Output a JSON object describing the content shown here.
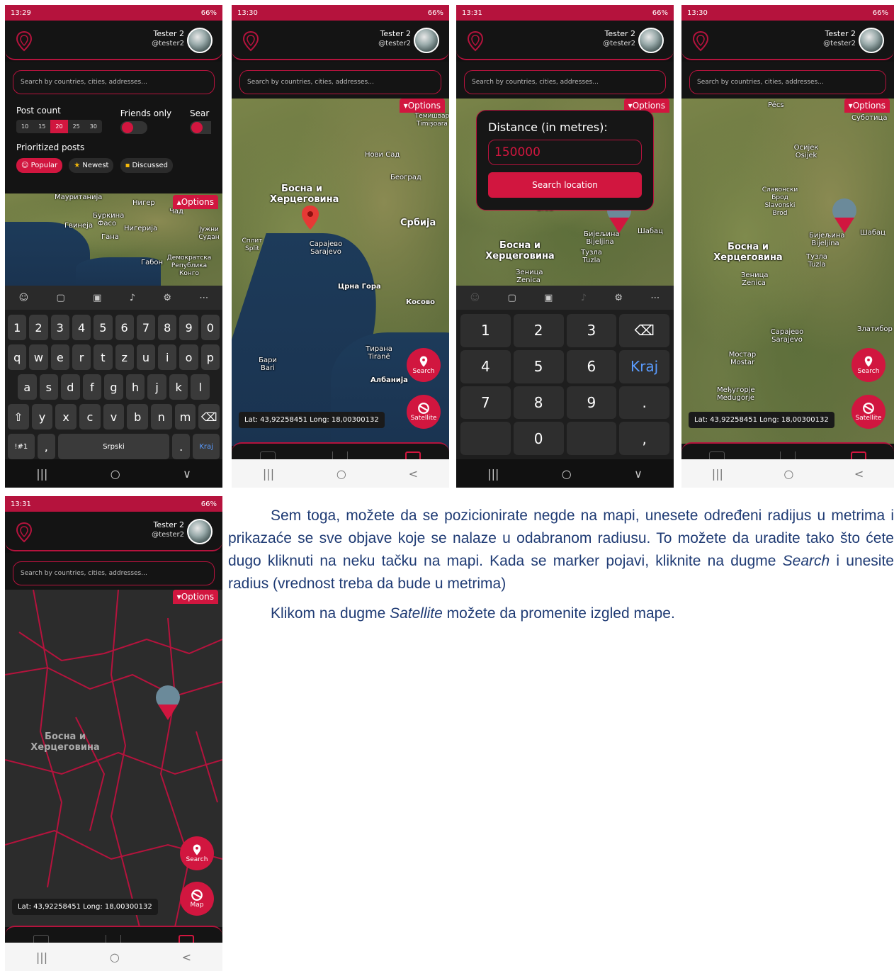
{
  "colors": {
    "accent": "#d1163f",
    "dark": "#141414"
  },
  "common": {
    "user_name": "Tester 2",
    "user_handle": "@tester2",
    "search_placeholder": "Search by countries, cities, addresses...",
    "options_label": "Options",
    "coords": "Lat: 43,92258451   Long: 18,00300132",
    "fab_search": "Search",
    "fab_satellite": "Satellite",
    "fab_map": "Map"
  },
  "phones": [
    {
      "time": "13:29",
      "status_right": "66%"
    },
    {
      "time": "13:30",
      "status_right": "66%"
    },
    {
      "time": "13:31",
      "status_right": "66%"
    },
    {
      "time": "13:30",
      "status_right": "66%"
    },
    {
      "time": "13:31",
      "status_right": "66%"
    }
  ],
  "filter_panel": {
    "post_count_label": "Post count",
    "post_counts": [
      "10",
      "15",
      "20",
      "25",
      "30"
    ],
    "post_count_selected": "20",
    "friends_only_label": "Friends only",
    "search_label": "Sear",
    "prioritized_label": "Prioritized posts",
    "chips": [
      "Popular",
      "Newest",
      "Discussed"
    ],
    "chip_selected": "Popular"
  },
  "keyboard": {
    "row_numbers": [
      "1",
      "2",
      "3",
      "4",
      "5",
      "6",
      "7",
      "8",
      "9",
      "0"
    ],
    "row_q": [
      "q",
      "w",
      "e",
      "r",
      "t",
      "z",
      "u",
      "i",
      "o",
      "p"
    ],
    "row_a": [
      "a",
      "s",
      "d",
      "f",
      "g",
      "h",
      "j",
      "k",
      "l"
    ],
    "row_y": [
      "⇧",
      "y",
      "x",
      "c",
      "v",
      "b",
      "n",
      "m",
      "⌫"
    ],
    "sym_key": "!#1",
    "comma": ",",
    "space_label": "Srpski",
    "period": ".",
    "enter_label": "Kraj"
  },
  "numpad": {
    "keys": [
      "1",
      "2",
      "3",
      "⌫",
      "4",
      "5",
      "6",
      "Kraj",
      "7",
      "8",
      "9",
      ".",
      "",
      "0",
      "",
      ","
    ]
  },
  "distance_dialog": {
    "title": "Distance (in metres):",
    "value": "150000",
    "button": "Search location"
  },
  "map_labels": {
    "p1": {
      "a": "Мауританија",
      "b": "Нигер",
      "c": "Чад",
      "d": "Буркина Фасо",
      "e": "Гвинеја",
      "f": "Нигерија",
      "g": "Гана",
      "h": "Габон",
      "i": "Демократска Република Конго",
      "j": "Јужни Судан"
    },
    "p2": {
      "a": "Босна и Херцеговина",
      "b": "Србија",
      "c": "Сарајево Sarajevo",
      "d": "Црна Гора",
      "e": "Косово",
      "f": "Тирана Tiranë",
      "g": "Албанија",
      "h": "Бари Bari",
      "i": "Сплит Split",
      "j": "Нови Сад",
      "k": "Београд",
      "l": "Темишвар Timișoara"
    },
    "p3": {
      "a": "Босна и Херцеговина",
      "b": "Зеница Zenica",
      "c": "Тузла Tuzla",
      "d": "Бијељина Bijeljina",
      "e": "Шабац",
      "f": "Brod"
    },
    "p4": {
      "a": "Босна и Херцеговина",
      "b": "Зеница Zenica",
      "c": "Тузла Tuzla",
      "d": "Бијељина Bijeljina",
      "e": "Сарајево Sarajevo",
      "f": "Мостар Mostar",
      "g": "Међугорје Medugorje",
      "h": "Осијек Osijek",
      "i": "Славонски Брод Slavonski Brod",
      "j": "Суботица",
      "k": "Pécs",
      "l": "Шабац",
      "m": "Златибор"
    },
    "p5": {
      "a": "Босна и Херцеговина"
    }
  },
  "paragraphs": {
    "p1_a": "Sem toga, možete da se pozicionirate negde na mapi, unesete određeni radijus u metrima i prikazaće se sve objave koje se nalaze u odabranom radiusu. To možete da uradite tako što ćete dugo kliknuti na neku tačku na mapi. Kada se marker pojavi, kliknite na dugme ",
    "p1_em": "Search",
    "p1_b": " i unesite radius (vrednost treba da bude u metrima)",
    "p2_a": "Klikom na dugme ",
    "p2_em": "Satellite",
    "p2_b": " možete da promenite izgled mape."
  }
}
